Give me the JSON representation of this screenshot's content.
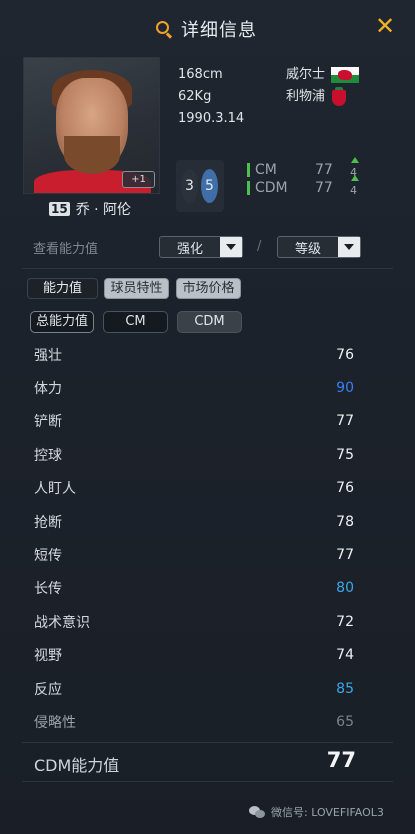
{
  "header": {
    "title": "详细信息",
    "close_symbol": "✕"
  },
  "player": {
    "photo_badge": "+1",
    "number": "15",
    "name": "乔 · 阿伦",
    "height": "168cm",
    "weight": "62Kg",
    "birthdate": "1990.3.14",
    "nation": "威尔士",
    "club": "利物浦",
    "left_foot": "3",
    "right_foot": "5"
  },
  "positions": [
    {
      "name": "CM",
      "value": "77",
      "plus": "4"
    },
    {
      "name": "CDM",
      "value": "77",
      "plus": "4"
    }
  ],
  "view": {
    "label": "查看能力值",
    "enhance_label": "强化",
    "separator": "/",
    "grade_label": "等级"
  },
  "tabs": [
    "能力值",
    "球员特性",
    "市场价格"
  ],
  "subtabs": [
    "总能力值",
    "CM",
    "CDM"
  ],
  "stats": [
    {
      "name": "强壮",
      "value": "76"
    },
    {
      "name": "体力",
      "value": "90"
    },
    {
      "name": "铲断",
      "value": "77"
    },
    {
      "name": "控球",
      "value": "75"
    },
    {
      "name": "人盯人",
      "value": "76"
    },
    {
      "name": "抢断",
      "value": "78"
    },
    {
      "name": "短传",
      "value": "77"
    },
    {
      "name": "长传",
      "value": "80"
    },
    {
      "name": "战术意识",
      "value": "72"
    },
    {
      "name": "视野",
      "value": "74"
    },
    {
      "name": "反应",
      "value": "85"
    },
    {
      "name": "侵略性",
      "value": "65"
    }
  ],
  "total": {
    "label": "CDM能力值",
    "value": "77"
  },
  "watermark": "微信号: LOVEFIFAOL3",
  "colors": {
    "accent": "#f1a22a",
    "blue": "#3a7ff0",
    "light_blue": "#3ea6e8",
    "green": "#4cc04a"
  }
}
